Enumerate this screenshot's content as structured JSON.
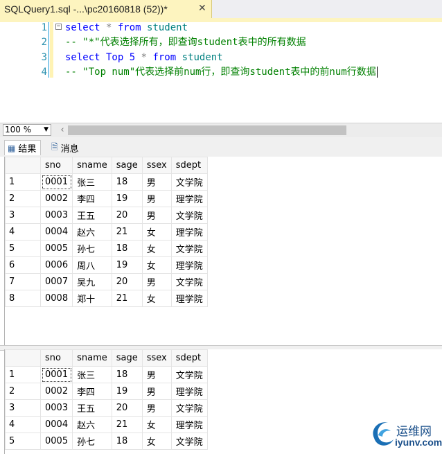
{
  "tab": {
    "title": "SQLQuery1.sql -...\\pc20160818 (52))*",
    "close": "✕"
  },
  "editor": {
    "lines": [
      {
        "num": "1",
        "kw1": "select",
        "op": " * ",
        "kw2": "from",
        "id": " student"
      },
      {
        "num": "2",
        "comment": "-- \"*\"代表选择所有，即查询student表中的所有数据"
      },
      {
        "num": "3",
        "kw1": "select",
        "mid": " Top 5 ",
        "op": "* ",
        "kw2": "from",
        "id": " student"
      },
      {
        "num": "4",
        "comment": "-- \"Top num\"代表选择前num行，即查询student表中的前num行数据"
      }
    ]
  },
  "zoom": {
    "value": "100 %"
  },
  "result_tabs": {
    "results": "结果",
    "messages": "消息"
  },
  "grid": {
    "columns": [
      "sno",
      "sname",
      "sage",
      "ssex",
      "sdept"
    ],
    "rows1": [
      [
        "1",
        "0001",
        "张三",
        "18",
        "男",
        "文学院"
      ],
      [
        "2",
        "0002",
        "李四",
        "19",
        "男",
        "理学院"
      ],
      [
        "3",
        "0003",
        "王五",
        "20",
        "男",
        "文学院"
      ],
      [
        "4",
        "0004",
        "赵六",
        "21",
        "女",
        "理学院"
      ],
      [
        "5",
        "0005",
        "孙七",
        "18",
        "女",
        "文学院"
      ],
      [
        "6",
        "0006",
        "周八",
        "19",
        "女",
        "理学院"
      ],
      [
        "7",
        "0007",
        "吴九",
        "20",
        "男",
        "文学院"
      ],
      [
        "8",
        "0008",
        "郑十",
        "21",
        "女",
        "理学院"
      ]
    ],
    "rows2": [
      [
        "1",
        "0001",
        "张三",
        "18",
        "男",
        "文学院"
      ],
      [
        "2",
        "0002",
        "李四",
        "19",
        "男",
        "理学院"
      ],
      [
        "3",
        "0003",
        "王五",
        "20",
        "男",
        "文学院"
      ],
      [
        "4",
        "0004",
        "赵六",
        "21",
        "女",
        "理学院"
      ],
      [
        "5",
        "0005",
        "孙七",
        "18",
        "女",
        "文学院"
      ]
    ]
  },
  "watermark": {
    "cn": "运维网",
    "url": "iyunv.com"
  }
}
